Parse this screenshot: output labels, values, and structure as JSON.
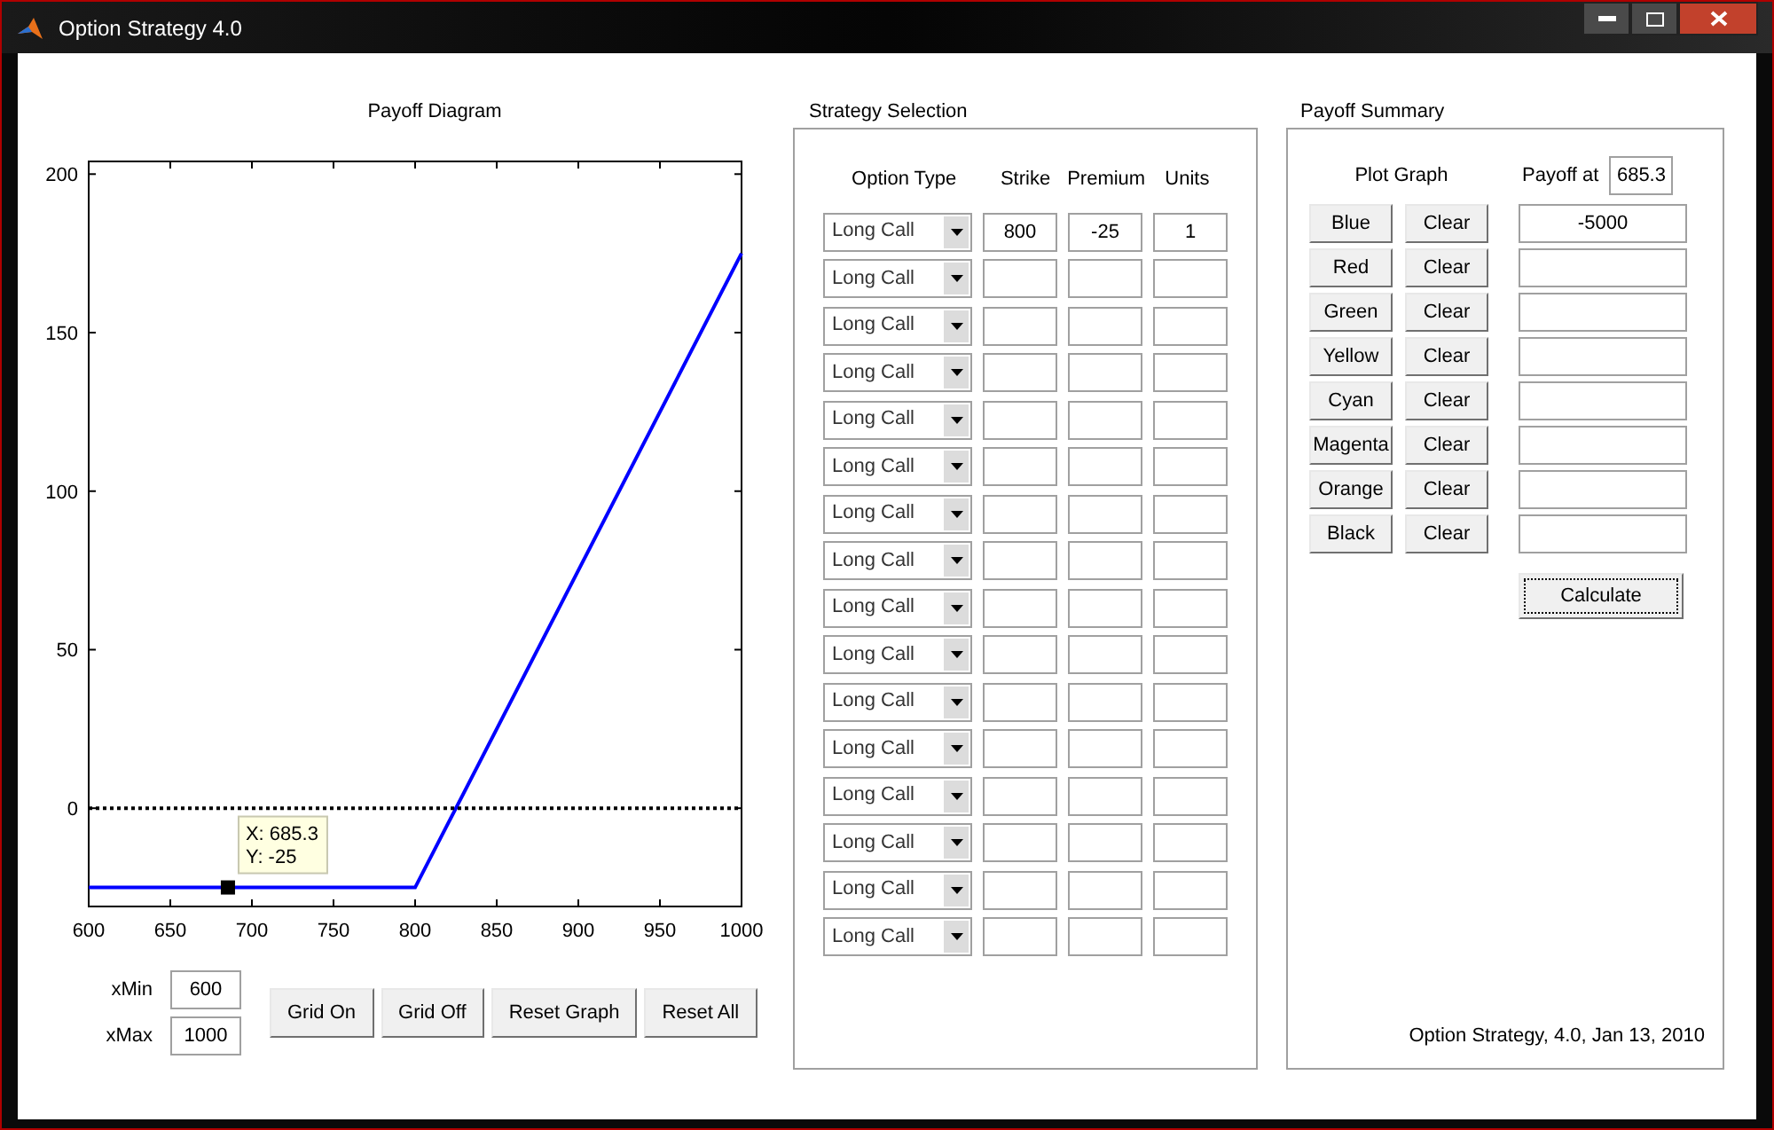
{
  "window": {
    "title": "Option Strategy 4.0"
  },
  "payoff_diagram": {
    "title": "Payoff Diagram",
    "chart_data": {
      "type": "line",
      "x": [
        600,
        800,
        1000
      ],
      "series": [
        {
          "color": "#0000ff",
          "line_style": "solid",
          "values": [
            -25,
            -25,
            175
          ]
        },
        {
          "color": "#000000",
          "line_style": "dotted",
          "values": [
            0,
            0,
            0
          ]
        }
      ],
      "xlim": [
        600,
        1000
      ],
      "ylim": [
        -31,
        204
      ],
      "xticks": [
        600,
        650,
        700,
        750,
        800,
        850,
        900,
        950,
        1000
      ],
      "yticks": [
        0,
        50,
        100,
        150,
        200
      ],
      "annotations": [
        {
          "x": 685.3,
          "y": -25,
          "text": "X: 685.3\nY: -25"
        }
      ]
    },
    "xmin": {
      "label": "xMin",
      "value": "600"
    },
    "xmax": {
      "label": "xMax",
      "value": "1000"
    },
    "buttons": [
      "Grid On",
      "Grid Off",
      "Reset Graph",
      "Reset All"
    ]
  },
  "strategy_selection": {
    "title": "Strategy Selection",
    "columns": [
      "Option Type",
      "Strike",
      "Premium",
      "Units"
    ],
    "rows": [
      {
        "option_type": "Long Call",
        "strike": "800",
        "premium": "-25",
        "units": "1"
      },
      {
        "option_type": "Long Call"
      },
      {
        "option_type": "Long Call"
      },
      {
        "option_type": "Long Call"
      },
      {
        "option_type": "Long Call"
      },
      {
        "option_type": "Long Call"
      },
      {
        "option_type": "Long Call"
      },
      {
        "option_type": "Long Call"
      },
      {
        "option_type": "Long Call"
      },
      {
        "option_type": "Long Call"
      },
      {
        "option_type": "Long Call"
      },
      {
        "option_type": "Long Call"
      },
      {
        "option_type": "Long Call"
      },
      {
        "option_type": "Long Call"
      },
      {
        "option_type": "Long Call"
      },
      {
        "option_type": "Long Call"
      }
    ]
  },
  "payoff_summary": {
    "title": "Payoff Summary",
    "plot_graph_label": "Plot Graph",
    "payoff_at_label": "Payoff at",
    "payoff_at_value": "685.3",
    "rows": [
      {
        "plot": "Blue",
        "clear": "Clear",
        "payoff": "-5000"
      },
      {
        "plot": "Red",
        "clear": "Clear"
      },
      {
        "plot": "Green",
        "clear": "Clear"
      },
      {
        "plot": "Yellow",
        "clear": "Clear"
      },
      {
        "plot": "Cyan",
        "clear": "Clear"
      },
      {
        "plot": "Magenta",
        "clear": "Clear"
      },
      {
        "plot": "Orange",
        "clear": "Clear"
      },
      {
        "plot": "Black",
        "clear": "Clear"
      }
    ],
    "calculate_button": "Calculate",
    "footer": "Option Strategy, 4.0, Jan 13, 2010"
  }
}
